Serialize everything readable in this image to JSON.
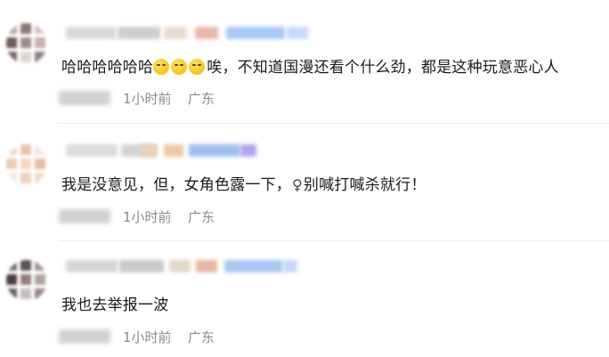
{
  "comments": [
    {
      "text_before_emoji": "哈哈哈哈哈哈",
      "emoji_count": 3,
      "emoji_icon": "smile-emoji-icon",
      "text_after_emoji": "唉，不知道国漫还看个什么劲，都是这种玩意恶心人",
      "time": "1小时前",
      "location": "广东",
      "avatar_colors": [
        "#b9a6a6",
        "#8d7777",
        "#d8c6c3",
        "#6f5b5b",
        "#a08c8c",
        "#c5b2b0",
        "#7b6767",
        "#e0d5d3",
        "#94807f"
      ],
      "header_colors": [
        "#d9d9d9",
        "#cfcfcf",
        "#e7dccd",
        "#e8b8a8",
        "#a9c9f3",
        "#c8dbf6"
      ]
    },
    {
      "text_before_icon": "我是没意见，但，女角色露一下，",
      "icon": "female-sign-icon",
      "icon_glyph": "♀",
      "text_after_icon": "别喊打喊杀就行！",
      "time": "1小时前",
      "location": "广东",
      "avatar_colors": [
        "#f0d9c8",
        "#e8c4ae",
        "#f6e4d6",
        "#eccab4",
        "#f3d7c3",
        "#e6bfa6",
        "#f7e6d9",
        "#efd0bb",
        "#f2dccb"
      ],
      "header_colors": [
        "#dcdcdc",
        "#d4d4d4",
        "#ebd2b8",
        "#f0c7a0",
        "#9fc0ef",
        "#b4a3ef"
      ]
    },
    {
      "text": "我也去举报一波",
      "time": "1小时前",
      "location": "广东",
      "avatar_colors": [
        "#7a6a6a",
        "#5f5050",
        "#a59595",
        "#4d3f3f",
        "#8f7f7f",
        "#b3a3a3",
        "#6d5d5d",
        "#c7bcbc",
        "#978787"
      ],
      "header_colors": [
        "#d6d6d6",
        "#c9c9c9",
        "#e3d9c8",
        "#e9b6a3",
        "#a9c8f2",
        "#c6daf5"
      ]
    }
  ]
}
